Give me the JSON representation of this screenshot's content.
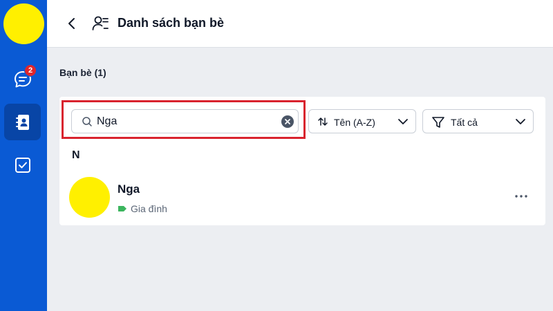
{
  "sidebar": {
    "chat_badge": "2",
    "items": [
      {
        "name": "chat",
        "icon": "chat-icon"
      },
      {
        "name": "contacts",
        "icon": "contact-book-icon",
        "active": true
      },
      {
        "name": "todo",
        "icon": "checkbox-icon"
      }
    ]
  },
  "header": {
    "title": "Danh sách bạn bè"
  },
  "section": {
    "title": "Bạn bè (1)"
  },
  "search": {
    "value": "Nga"
  },
  "sort": {
    "label": "Tên (A-Z)"
  },
  "filter": {
    "label": "Tất cả"
  },
  "groups": [
    {
      "letter": "N",
      "contacts": [
        {
          "name": "Nga",
          "tag": "Gia đình",
          "tag_color": "#3cb55e"
        }
      ]
    }
  ],
  "colors": {
    "sidebar": "#0a5ad4",
    "sidebar_active": "#0845a6",
    "badge": "#e0262b",
    "highlight": "#d9232e",
    "avatar": "#fff000"
  }
}
